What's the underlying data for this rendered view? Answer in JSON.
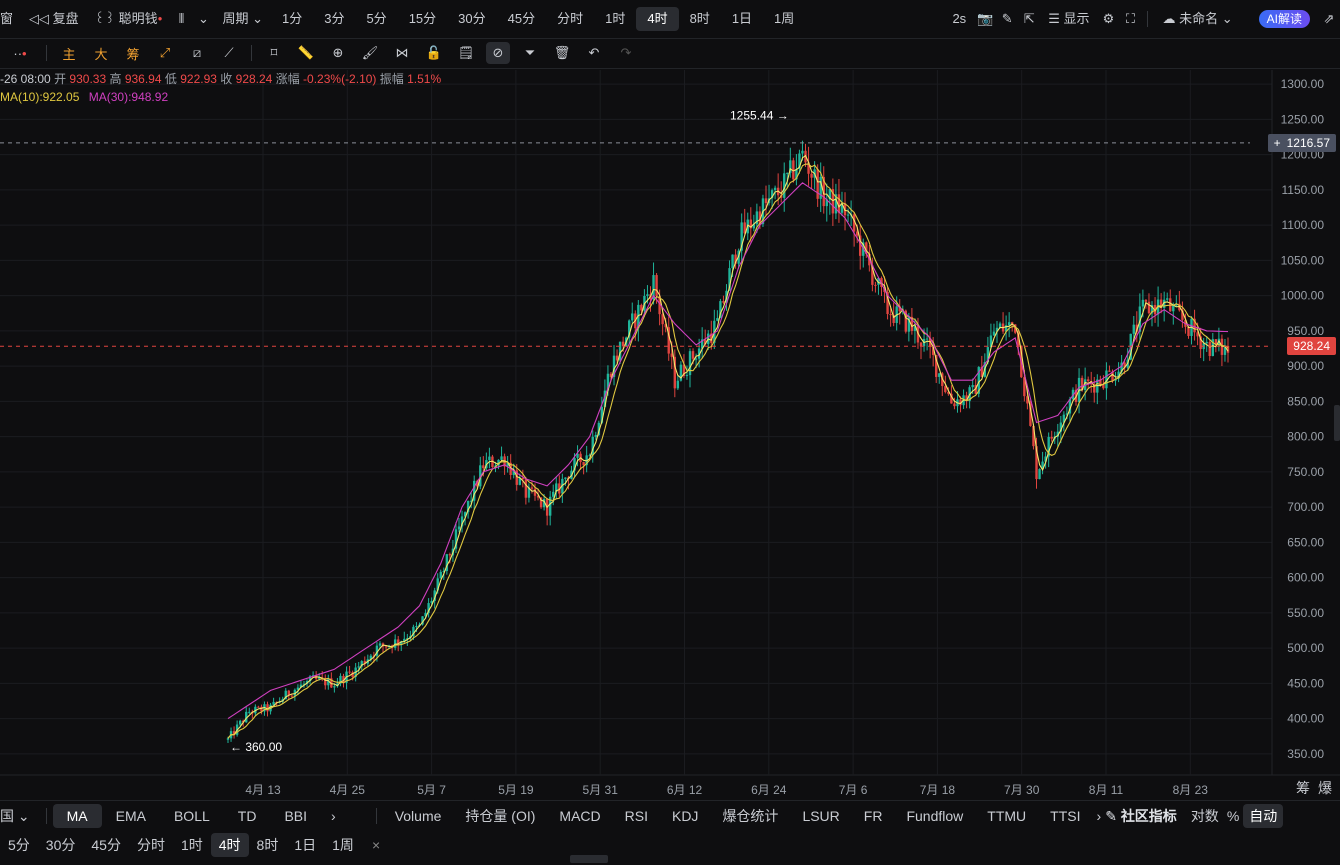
{
  "topbar": {
    "window_label": "窗",
    "replay_label": "复盘",
    "smart_money_label": "聪明钱",
    "period_label": "周期",
    "timeframes": [
      "1分",
      "3分",
      "5分",
      "15分",
      "30分",
      "45分",
      "分时",
      "1时",
      "4时",
      "8时",
      "1日",
      "1周"
    ],
    "active_timeframe": "4时",
    "refresh_label": "2s",
    "display_label": "显示",
    "layout_name": "未命名",
    "ai_label": "AI解读"
  },
  "toolbar": {
    "indicator_tabs": [
      "主",
      "大",
      "筹"
    ]
  },
  "info": {
    "date": "-26 08:00",
    "open_label": "开",
    "open": "930.33",
    "high_label": "高",
    "high": "936.94",
    "low_label": "低",
    "low": "922.93",
    "close_label": "收",
    "close": "928.24",
    "change_label": "涨幅",
    "change": "-0.23%(-2.10)",
    "amplitude_label": "振幅",
    "amplitude": "1.51%",
    "ma10": "MA(10):922.05",
    "ma30": "MA(30):948.92"
  },
  "price_tags": {
    "crosshair": "1216.57",
    "last": "928.24",
    "high_marker": "1255.44 →",
    "low_marker": "← 360.00"
  },
  "colors": {
    "up": "#1fb59b",
    "down": "#e0443f",
    "ma5": "#f5e86a",
    "ma10": "#e0c840",
    "ma30": "#d040c0",
    "last_price": "#e0443f"
  },
  "chart_data": {
    "type": "candlestick",
    "title": "",
    "xlabel": "",
    "ylabel": "",
    "ylim": [
      320,
      1320
    ],
    "y_ticks": [
      1300,
      1250,
      1200,
      1150,
      1100,
      1050,
      1000,
      950,
      900,
      850,
      800,
      750,
      700,
      650,
      600,
      550,
      500,
      450,
      400,
      350
    ],
    "x_ticks": [
      "4月 13",
      "4月 25",
      "5月 7",
      "5月 19",
      "5月 31",
      "6月 12",
      "6月 24",
      "7月 6",
      "7月 18",
      "7月 30",
      "8月 11",
      "8月 23"
    ],
    "series": [
      {
        "name": "MA(10)",
        "kind": "price-path",
        "values": [
          370,
          410,
          415,
          440,
          455,
          450,
          470,
          500,
          510,
          530,
          600,
          680,
          760,
          770,
          720,
          700,
          750,
          780,
          900,
          960,
          1020,
          880,
          920,
          960,
          1080,
          1120,
          1150,
          1200,
          1140,
          1120,
          1050,
          980,
          960,
          920,
          850,
          860,
          950,
          960,
          750,
          820,
          870,
          880,
          900,
          980,
          990,
          960,
          930,
          922
        ]
      },
      {
        "name": "MA(30)",
        "kind": "ma",
        "values": [
          400,
          420,
          440,
          450,
          460,
          470,
          490,
          510,
          530,
          560,
          620,
          700,
          750,
          760,
          740,
          730,
          760,
          800,
          880,
          940,
          1000,
          960,
          930,
          950,
          1040,
          1100,
          1130,
          1160,
          1140,
          1110,
          1060,
          1000,
          970,
          940,
          880,
          880,
          920,
          940,
          820,
          830,
          870,
          880,
          900,
          960,
          980,
          960,
          950,
          948.92
        ]
      }
    ]
  },
  "bottom": {
    "main_select": "国",
    "main_indicators": [
      "MA",
      "EMA",
      "BOLL",
      "TD",
      "BBI"
    ],
    "active_main": "MA",
    "sub_indicators": [
      "Volume",
      "持仓量 (OI)",
      "MACD",
      "RSI",
      "KDJ",
      "爆仓统计",
      "LSUR",
      "FR",
      "Fundflow",
      "TTMU",
      "TTSI"
    ],
    "community_label": "社区指标",
    "log_label": "对数",
    "pct_label": "%",
    "auto_label": "自动",
    "timeframes": [
      "5分",
      "30分",
      "45分",
      "分时",
      "1时",
      "4时",
      "8时",
      "1日",
      "1周"
    ],
    "active_timeframe": "4时",
    "close_mark": "×",
    "right_labels": [
      "筹",
      "爆"
    ]
  }
}
